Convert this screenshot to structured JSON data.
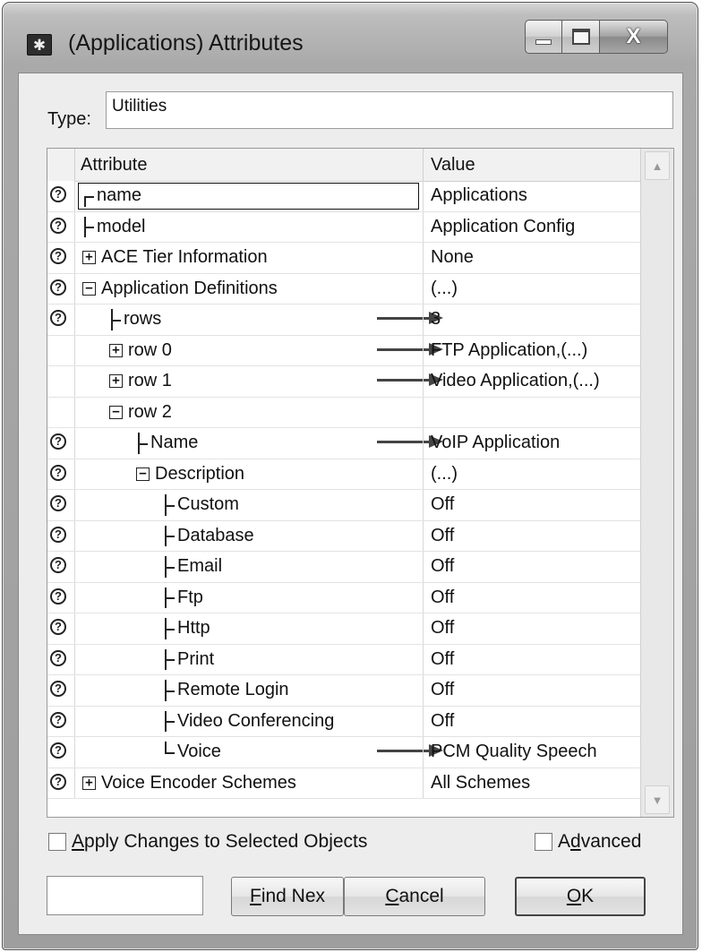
{
  "window": {
    "title": "(Applications) Attributes",
    "icon": "asterisk-app-icon",
    "controls": {
      "minimize": "minimize-icon",
      "maximize": "maximize-icon",
      "close": "close-icon",
      "close_glyph": "X"
    }
  },
  "type": {
    "label": "Type:",
    "value": "Utilities"
  },
  "grid": {
    "header": {
      "attribute": "Attribute",
      "value": "Value"
    },
    "rows": [
      {
        "label": "name",
        "value": "Applications",
        "help": true
      },
      {
        "label": "model",
        "value": "Application Config",
        "help": true
      },
      {
        "label": "ACE Tier Information",
        "value": "None",
        "help": true,
        "expander": "+"
      },
      {
        "label": "Application Definitions",
        "value": "(...)",
        "help": true,
        "expander": "−"
      },
      {
        "label": "rows",
        "value": "3",
        "help": true
      },
      {
        "label": "row 0",
        "value": "FTP Application,(...)",
        "help": false,
        "expander": "+"
      },
      {
        "label": "row 1",
        "value": "Video Application,(...)",
        "help": false,
        "expander": "+"
      },
      {
        "label": "row 2",
        "value": "",
        "help": false,
        "expander": "−"
      },
      {
        "label": "Name",
        "value": "VoIP Application",
        "help": true
      },
      {
        "label": "Description",
        "value": "(...)",
        "help": true,
        "expander": "−"
      },
      {
        "label": "Custom",
        "value": "Off",
        "help": true
      },
      {
        "label": "Database",
        "value": "Off",
        "help": true
      },
      {
        "label": "Email",
        "value": "Off",
        "help": true
      },
      {
        "label": "Ftp",
        "value": "Off",
        "help": true
      },
      {
        "label": "Http",
        "value": "Off",
        "help": true
      },
      {
        "label": "Print",
        "value": "Off",
        "help": true
      },
      {
        "label": "Remote Login",
        "value": "Off",
        "help": true
      },
      {
        "label": "Video Conferencing",
        "value": "Off",
        "help": true
      },
      {
        "label": "Voice",
        "value": "PCM Quality Speech",
        "help": true
      },
      {
        "label": "Voice Encoder Schemes",
        "value": "All Schemes",
        "help": true,
        "expander": "+"
      }
    ],
    "help_glyph": "?",
    "scroll_up_glyph": "▲",
    "scroll_down_glyph": "▼"
  },
  "options": {
    "apply_changes": {
      "pre": "",
      "accel": "A",
      "post": "pply Changes to Selected Objects",
      "checked": false
    },
    "advanced": {
      "pre": "A",
      "accel": "d",
      "post": "vanced",
      "checked": false
    }
  },
  "buttons": {
    "find_next": {
      "accel": "F",
      "rest": "ind Nex"
    },
    "cancel": {
      "accel": "C",
      "rest": "ancel"
    },
    "ok": {
      "accel": "O",
      "rest": "K"
    }
  },
  "find_input": {
    "value": ""
  }
}
